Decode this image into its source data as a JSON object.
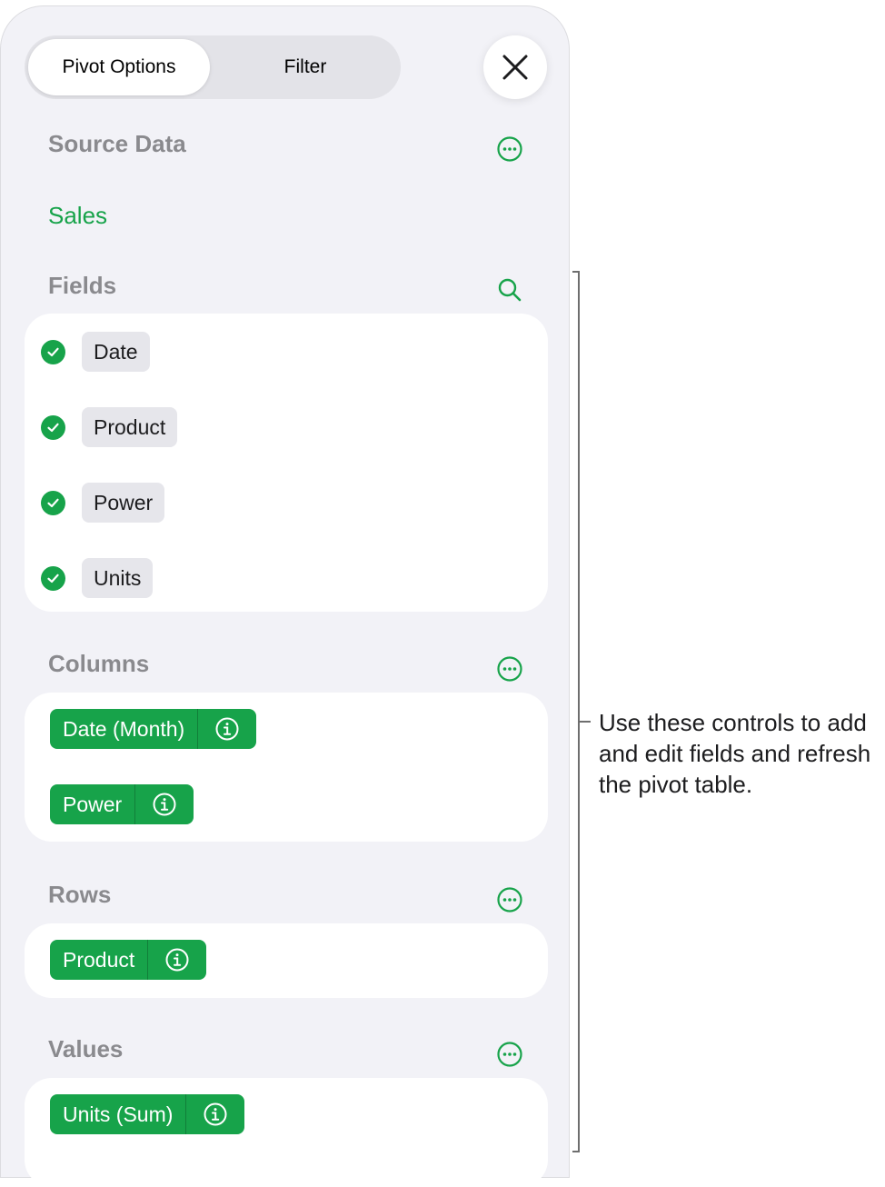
{
  "tabs": {
    "pivot_options": "Pivot Options",
    "filter": "Filter"
  },
  "sections": {
    "source_data": {
      "title": "Source Data",
      "value": "Sales"
    },
    "fields": {
      "title": "Fields",
      "items": [
        "Date",
        "Product",
        "Power",
        "Units"
      ]
    },
    "columns": {
      "title": "Columns",
      "items": [
        "Date (Month)",
        "Power"
      ]
    },
    "rows": {
      "title": "Rows",
      "items": [
        "Product"
      ]
    },
    "values": {
      "title": "Values",
      "items": [
        "Units (Sum)"
      ]
    }
  },
  "callout": "Use these controls to add and edit fields and refresh the pivot table.",
  "colors": {
    "accent": "#17a34a",
    "panel_bg": "#f2f2f7",
    "section_title": "#8a8a8e"
  },
  "icons": {
    "close": "close-icon",
    "more": "ellipsis-circle-icon",
    "search": "search-icon",
    "check": "checkmark-circle-icon",
    "info": "info-circle-icon"
  }
}
